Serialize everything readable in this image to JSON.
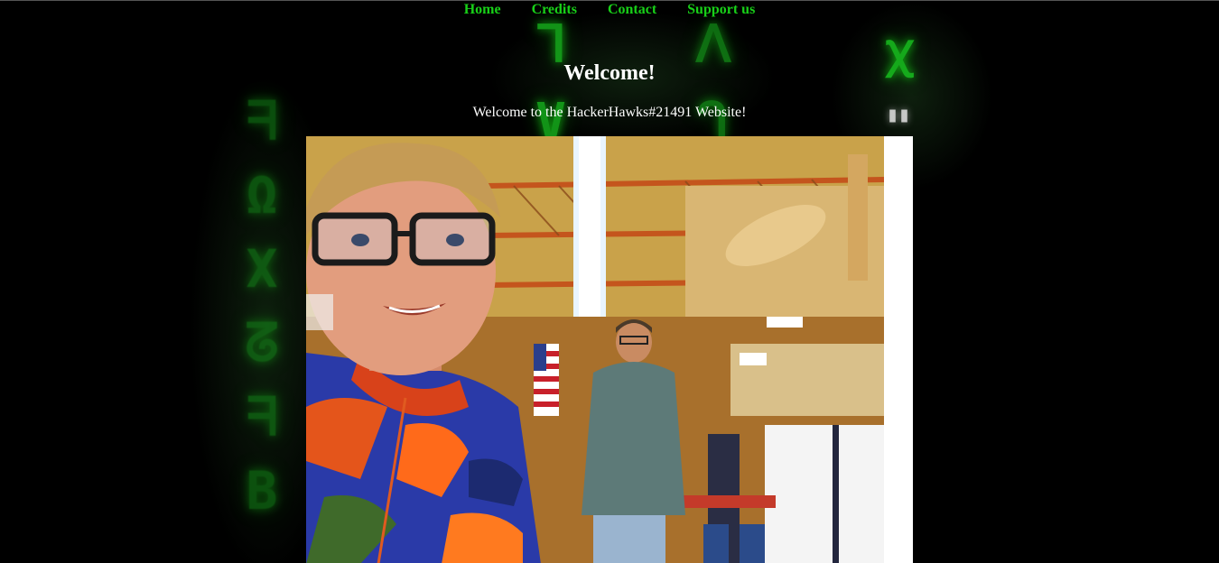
{
  "nav": {
    "items": [
      {
        "label": "Home"
      },
      {
        "label": "Credits"
      },
      {
        "label": "Contact"
      },
      {
        "label": "Support us"
      }
    ]
  },
  "main": {
    "title": "Welcome!",
    "subtitle": "Welcome to the HackerHawks#21491 Website!"
  },
  "background": {
    "left_column_glyphs": "ᖷΩXᘔᖷB",
    "top_column_1_glyphs": "ᒣV",
    "top_column_2_glyphs": "ᐱᒉ",
    "right_column_glyphs": "ꭓ\"",
    "glyph_color": "#18c41f"
  },
  "colors": {
    "page_background": "#000000",
    "nav_link": "#18d018",
    "heading_text": "#ffffff"
  }
}
